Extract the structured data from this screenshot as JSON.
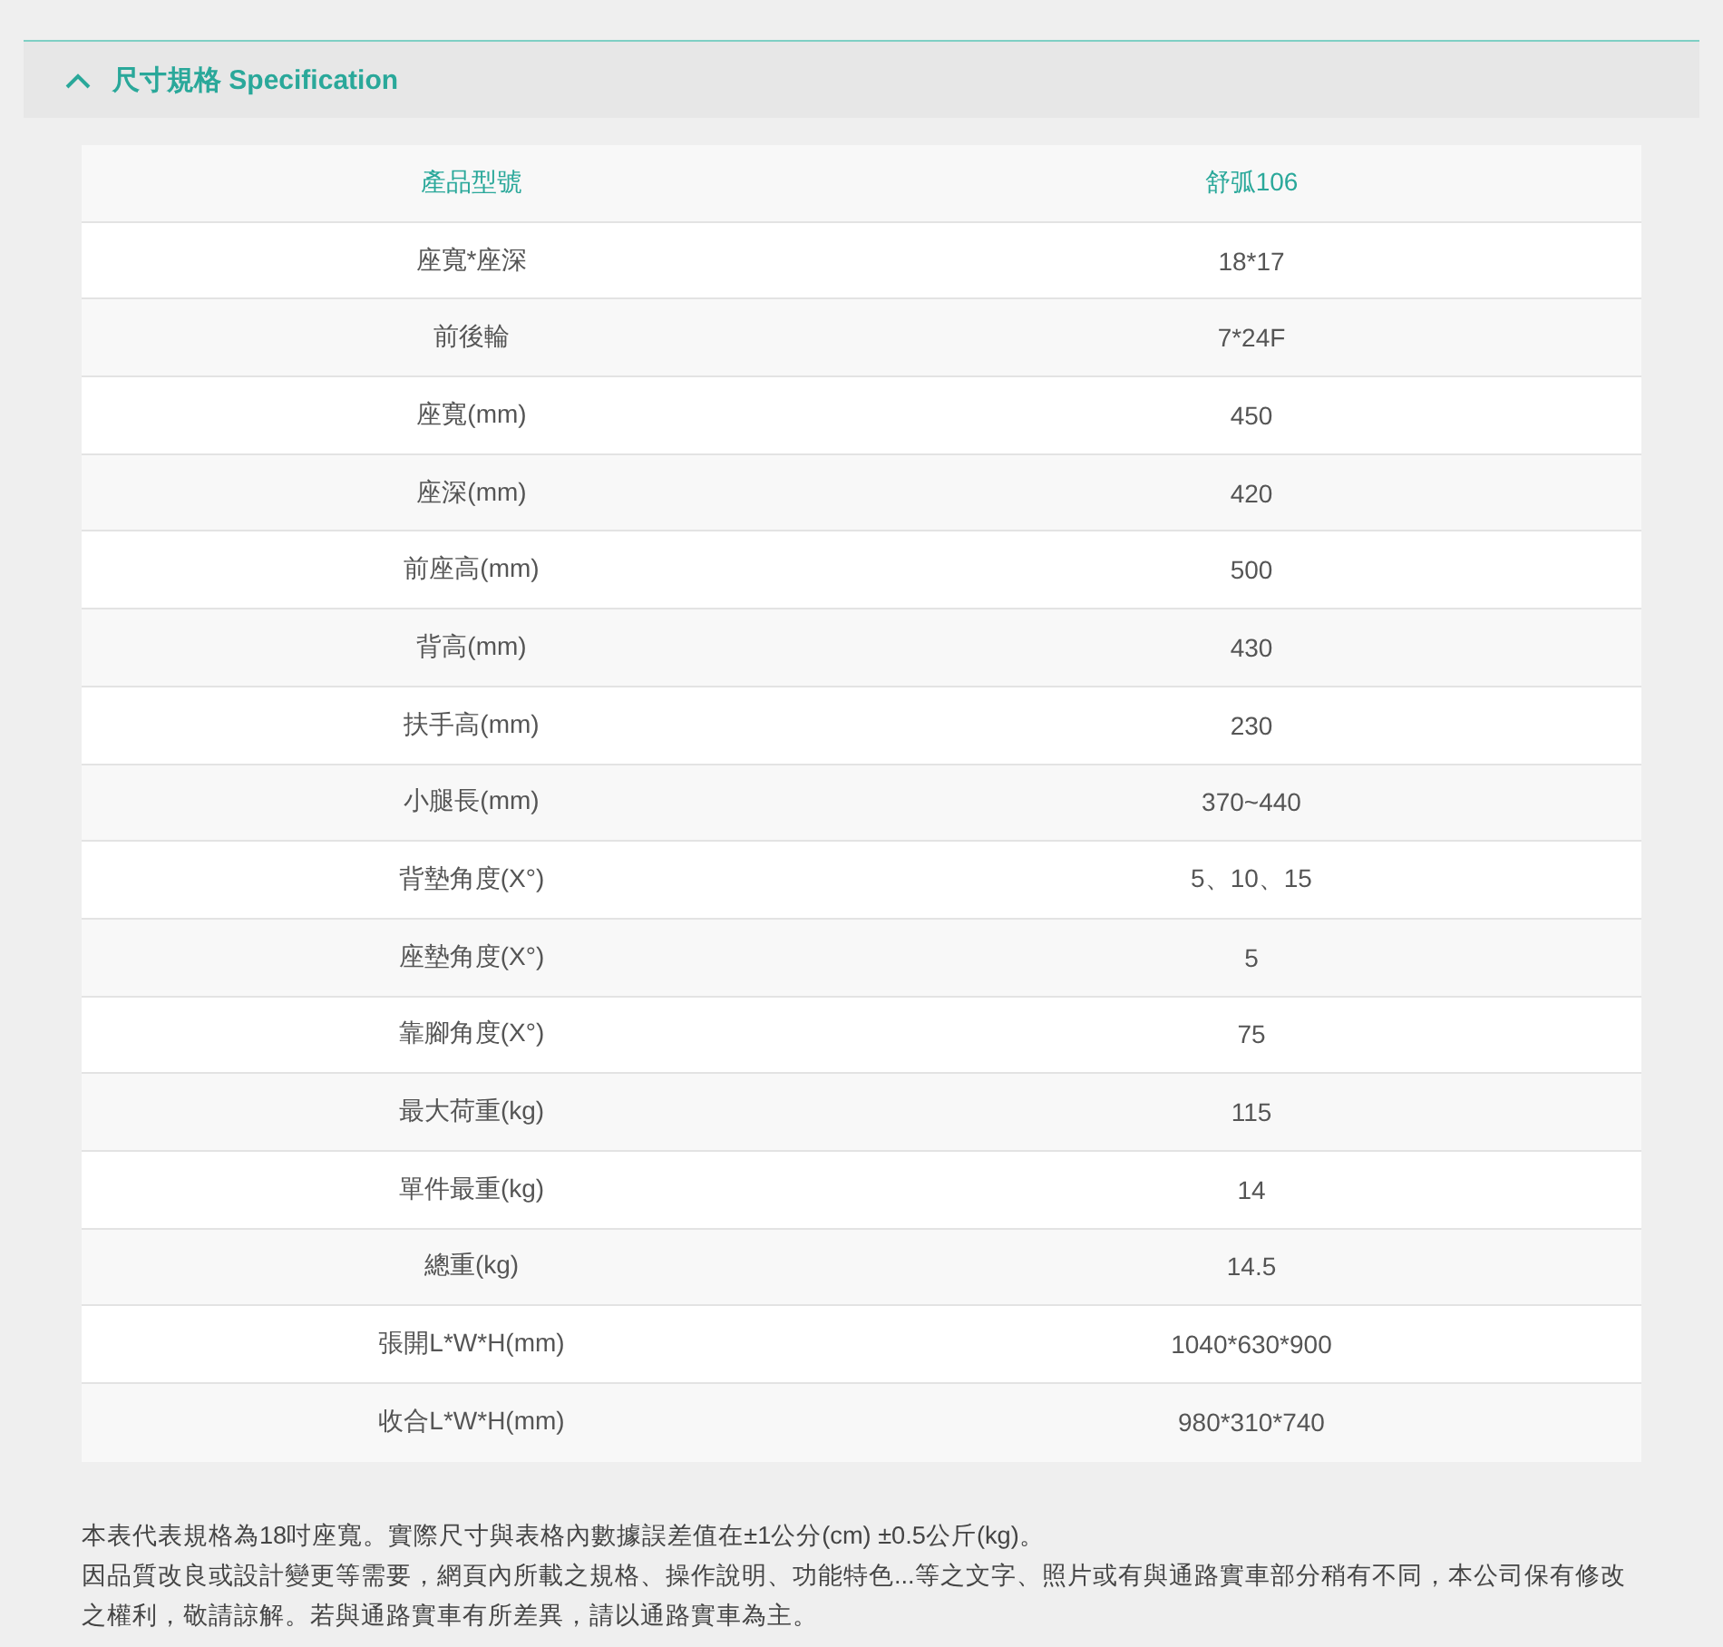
{
  "section": {
    "title": "尺寸規格 Specification",
    "expanded": true
  },
  "table": {
    "header": [
      "產品型號",
      "舒弧106"
    ],
    "rows": [
      [
        "座寬*座深",
        "18*17"
      ],
      [
        "前後輪",
        "7*24F"
      ],
      [
        "座寬(mm)",
        "450"
      ],
      [
        "座深(mm)",
        "420"
      ],
      [
        "前座高(mm)",
        "500"
      ],
      [
        "背高(mm)",
        "430"
      ],
      [
        "扶手高(mm)",
        "230"
      ],
      [
        "小腿長(mm)",
        "370~440"
      ],
      [
        "背墊角度(X°)",
        "5、10、15"
      ],
      [
        "座墊角度(X°)",
        "5"
      ],
      [
        "靠腳角度(X°)",
        "75"
      ],
      [
        "最大荷重(kg)",
        "115"
      ],
      [
        "單件最重(kg)",
        "14"
      ],
      [
        "總重(kg)",
        "14.5"
      ],
      [
        "張開L*W*H(mm)",
        "1040*630*900"
      ],
      [
        "收合L*W*H(mm)",
        "980*310*740"
      ]
    ]
  },
  "notes": [
    "本表代表規格為18吋座寬。實際尺寸與表格內數據誤差值在±1公分(cm) ±0.5公斤(kg)。",
    "因品質改良或設計變更等需要，網頁內所載之規格、操作說明、功能特色...等之文字、照片或有與通路實車部分稍有不同，本公司保有修改之權利，敬請諒解。若與通路實車有所差異，請以通路實車為主。"
  ]
}
